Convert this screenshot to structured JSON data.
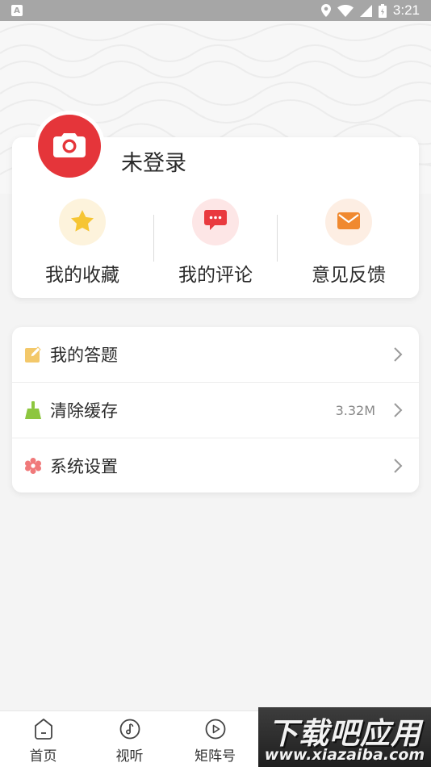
{
  "status_bar": {
    "notification_badge": "A",
    "time": "3:21",
    "icons": [
      "location-icon",
      "wifi-icon",
      "signal-icon",
      "battery-icon"
    ]
  },
  "profile": {
    "avatar_icon": "camera-icon",
    "login_label": "未登录"
  },
  "quick_actions": [
    {
      "label": "我的收藏",
      "icon": "star-icon",
      "color": "#f6c533",
      "bg": "#fdf3dc"
    },
    {
      "label": "我的评论",
      "icon": "comment-icon",
      "color": "#e93a3f",
      "bg": "#fde6e6"
    },
    {
      "label": "意见反馈",
      "icon": "mail-icon",
      "color": "#f0892f",
      "bg": "#fdeee3"
    }
  ],
  "menu": [
    {
      "label": "我的答题",
      "icon": "edit-note-icon",
      "value": "",
      "color": "#f3c86a"
    },
    {
      "label": "清除缓存",
      "icon": "broom-icon",
      "value": "3.32M",
      "color": "#8dc63f"
    },
    {
      "label": "系统设置",
      "icon": "settings-icon",
      "value": "",
      "color": "#f0797a"
    }
  ],
  "tabbar": [
    {
      "label": "首页",
      "icon": "home-icon"
    },
    {
      "label": "视听",
      "icon": "music-note-icon"
    },
    {
      "label": "矩阵号",
      "icon": "play-icon"
    }
  ],
  "watermark": {
    "title": "下载吧应用",
    "url": "www.xiazaiba.com"
  },
  "colors": {
    "accent_red": "#e5353a",
    "background": "#f4f4f4",
    "card": "#ffffff"
  }
}
